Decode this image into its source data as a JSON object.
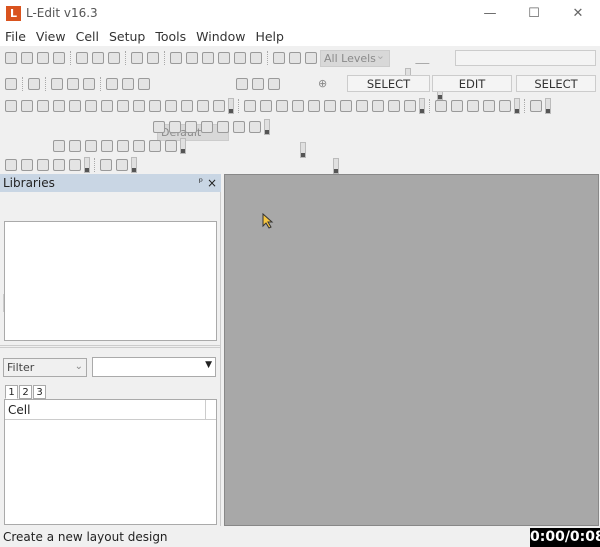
{
  "window": {
    "title": "L-Edit v16.3",
    "logo": "L",
    "minimize": "—",
    "maximize": "☐",
    "close": "✕"
  },
  "menu": [
    "File",
    "View",
    "Cell",
    "Setup",
    "Tools",
    "Window",
    "Help"
  ],
  "toolbar": {
    "row1": [
      "new-icon",
      "open-icon",
      "save-all-icon",
      "print-icon",
      "|",
      "cut-icon",
      "copy-icon",
      "paste-icon",
      "|",
      "undo-icon",
      "redo-icon",
      "|",
      "fit-icon",
      "zoom-box-icon",
      "find-icon",
      "find-next-icon",
      "find-prev-icon",
      "tools-icon",
      "|",
      "hierarchy-icon",
      "search-icon",
      "layers-icon"
    ],
    "row2a": [
      "pointer-icon",
      "|",
      "box-icon",
      "|",
      "polygon-icon",
      "polygon45-icon",
      "triangle-icon",
      "|",
      "wire-icon",
      "line-icon",
      "curve-icon"
    ],
    "row2b": [
      "port-icon",
      "port-text-icon",
      "port-label-icon"
    ],
    "row3": [
      "merge-icon",
      "slice-icon",
      "slice2-icon",
      "flip-icon",
      "rotate-icon",
      "align-icon",
      "array-icon",
      "group-icon",
      "ungroup-icon",
      "instance-icon",
      "bbox-icon",
      "grid-icon",
      "chain-icon",
      "distribute-icon",
      "G",
      "|",
      "boolean-icon",
      "grow-icon",
      "corner-icon",
      "notch-icon",
      "circle-icon",
      "torus-icon",
      "pattern-icon",
      "ruler-icon",
      "cross-section-icon",
      "magnet-icon",
      "wrench-icon",
      "G",
      "|",
      "drc-icon",
      "pin-icon",
      "netlist-icon",
      "chip-icon",
      "extract-icon",
      "G",
      "|",
      "node-icon",
      "G"
    ],
    "row4": [
      "drc-run-icon",
      "ext-run-icon",
      "drc-box-icon",
      "drc-setup-icon",
      "ext-setup-icon",
      "lvs-icon",
      "compare-icon",
      "G"
    ],
    "row5": [
      "inspect-icon",
      "refresh-icon",
      "highlight-icon",
      "zoom-error-icon",
      "mark-icon",
      "check-icon",
      "navigate-icon",
      "config-icon",
      "G"
    ],
    "row6": [
      "flag1-icon",
      "flag2-icon",
      "flag3-icon",
      "wrench2-icon",
      "stop-icon",
      "G",
      "|",
      "pen-icon",
      "net-icon",
      "G"
    ],
    "levels": "All Levels",
    "default": "Default",
    "modes": [
      "SELECT",
      "EDIT",
      "SELECT"
    ]
  },
  "libraries": {
    "title": "Libraries",
    "pin": "ᵖ",
    "close": "×",
    "filter": "Filter",
    "tabs": [
      "1",
      "2",
      "3"
    ],
    "column": "Cell"
  },
  "status": {
    "text": "Create a new layout design",
    "timer": "0:00/0:08"
  }
}
